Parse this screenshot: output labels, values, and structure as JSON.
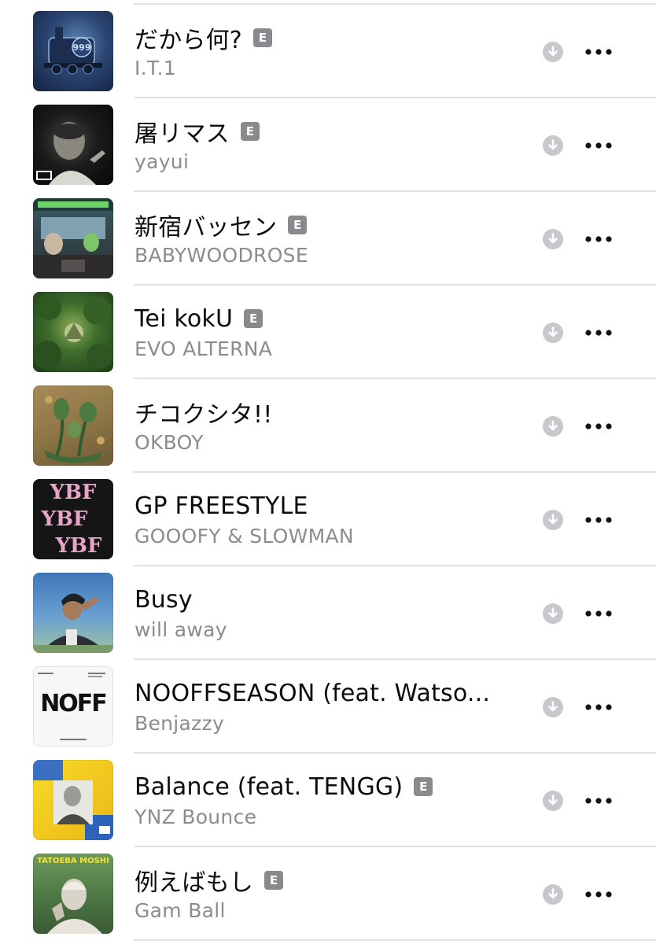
{
  "icons": {
    "download": "download-icon",
    "more": "more-icon",
    "explicit_badge": "E"
  },
  "colors": {
    "title": "#0c0c0c",
    "artist": "#8c8c90",
    "explicit_badge": "#8a8a8e",
    "download_icon": "#c7c7cc",
    "more_icon": "#111111",
    "separator": "#e2e2e6"
  },
  "tracks": [
    {
      "title": "だから何?",
      "artist": "I.T.1",
      "explicit": true,
      "art_text": "999",
      "art_bg": "#263a5e",
      "art_fg": "#9fc3e8"
    },
    {
      "title": "屠リマス",
      "artist": "yayui",
      "explicit": true,
      "art_text": "",
      "art_bg": "#111111",
      "art_fg": "#cccccc"
    },
    {
      "title": "新宿バッセン",
      "artist": "BABYWOODROSE",
      "explicit": true,
      "art_text": "",
      "art_bg": "#2f4a4a",
      "art_fg": "#6fd36a"
    },
    {
      "title": "Tei kokU",
      "artist": "EVO ALTERNA",
      "explicit": true,
      "art_text": "",
      "art_bg": "#3c6a2c",
      "art_fg": "#a6c777"
    },
    {
      "title": "チコクシタ!!",
      "artist": "OKBOY",
      "explicit": false,
      "art_text": "",
      "art_bg": "#8a7a4a",
      "art_fg": "#3f6b3a"
    },
    {
      "title": "GP FREESTYLE",
      "artist": "GOOOFY & SLOWMAN",
      "explicit": false,
      "art_text": "YBF",
      "art_bg": "#151515",
      "art_fg": "#e7a6c8"
    },
    {
      "title": "Busy",
      "artist": "will away",
      "explicit": false,
      "art_text": "",
      "art_bg": "#5d8fc1",
      "art_fg": "#2c2f35"
    },
    {
      "title": "NOOFFSEASON (feat. Watso...",
      "artist": "Benjazzy",
      "explicit": false,
      "art_text": "NOFF",
      "art_bg": "#f7f7f7",
      "art_fg": "#111111"
    },
    {
      "title": "Balance (feat. TENGG)",
      "artist": "YNZ Bounce",
      "explicit": true,
      "art_text": "",
      "art_bg": "#f2d42a",
      "art_fg": "#2d63b8"
    },
    {
      "title": "例えばもし",
      "artist": "Gam Ball",
      "explicit": true,
      "art_text": "TATOEBA MOSHI",
      "art_bg": "#4f7a46",
      "art_fg": "#f2e23a"
    }
  ]
}
